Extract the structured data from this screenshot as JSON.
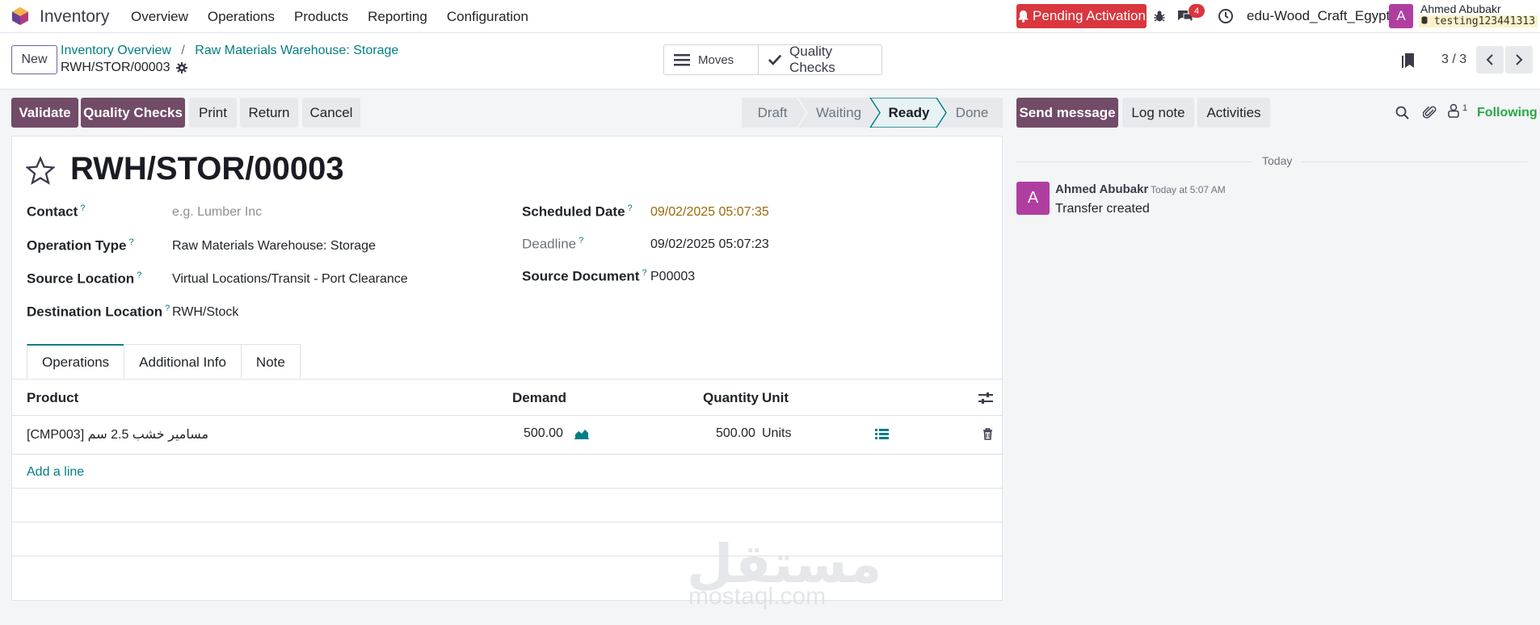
{
  "navbar": {
    "app_name": "Inventory",
    "menu": [
      "Overview",
      "Operations",
      "Products",
      "Reporting",
      "Configuration"
    ],
    "pending_label": "Pending Activation",
    "messages_badge": "4",
    "company": "edu-Wood_Craft_Egypt",
    "avatar_letter": "A",
    "user_name": "Ahmed Abubakr",
    "db_name": "testing123441313"
  },
  "control": {
    "new_label": "New",
    "breadcrumb": [
      "Inventory Overview",
      "Raw Materials Warehouse: Storage"
    ],
    "record_name": "RWH/STOR/00003",
    "smart_buttons": {
      "moves": "Moves",
      "quality_checks": "Quality Checks"
    },
    "pager": "3 / 3"
  },
  "actions": {
    "validate": "Validate",
    "quality_checks": "Quality Checks",
    "print": "Print",
    "return": "Return",
    "cancel": "Cancel"
  },
  "stages": {
    "draft": "Draft",
    "waiting": "Waiting",
    "ready": "Ready",
    "done": "Done",
    "current": "Ready"
  },
  "form": {
    "title": "RWH/STOR/00003",
    "help_mark": "?",
    "labels": {
      "contact": "Contact",
      "operation_type": "Operation Type",
      "source_location": "Source Location",
      "destination_location": "Destination Location",
      "scheduled_date": "Scheduled Date",
      "deadline": "Deadline",
      "source_document": "Source Document"
    },
    "values": {
      "contact_placeholder": "e.g. Lumber Inc",
      "operation_type": "Raw Materials Warehouse: Storage",
      "source_location": "Virtual Locations/Transit - Port Clearance",
      "destination_location": "RWH/Stock",
      "scheduled_date": "09/02/2025 05:07:35",
      "deadline": "09/02/2025 05:07:23",
      "source_document": "P00003"
    },
    "tabs": [
      "Operations",
      "Additional Info",
      "Note"
    ],
    "table": {
      "headers": {
        "product": "Product",
        "demand": "Demand",
        "quantity": "Quantity",
        "unit": "Unit"
      },
      "rows": [
        {
          "product": "[CMP003] مسامير خشب 2.5 سم",
          "demand": "500.00",
          "quantity": "500.00",
          "unit": "Units"
        }
      ],
      "add_line": "Add a line"
    }
  },
  "chatter": {
    "send_message": "Send message",
    "log_note": "Log note",
    "activities": "Activities",
    "followers_count": "1",
    "following": "Following",
    "date_separator": "Today",
    "message": {
      "avatar_letter": "A",
      "author": "Ahmed Abubakr",
      "time": "Today at 5:07 AM",
      "body": "Transfer created"
    }
  },
  "watermark": {
    "arabic": "مستقل",
    "latin": "mostaql.com"
  },
  "colors": {
    "primary": "#714b67",
    "link": "#017e84",
    "danger": "#d9363e",
    "avatar": "#b03ea1",
    "following": "#28a745"
  }
}
